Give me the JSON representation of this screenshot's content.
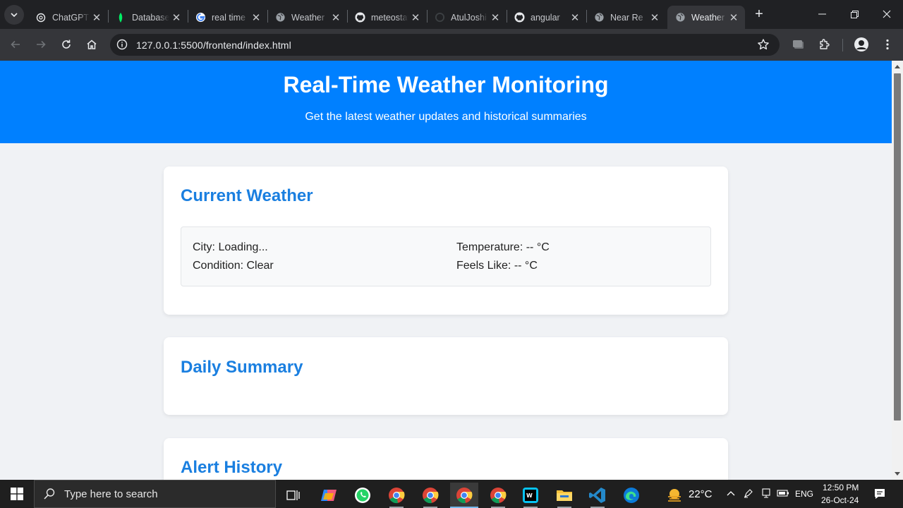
{
  "browser": {
    "tabs": [
      {
        "title": "ChatGPT",
        "favicon": "chatgpt-icon"
      },
      {
        "title": "Database",
        "favicon": "mongodb-leaf-icon"
      },
      {
        "title": "real time",
        "favicon": "google-icon"
      },
      {
        "title": "Weather",
        "favicon": "globe-icon"
      },
      {
        "title": "meteostat",
        "favicon": "github-icon"
      },
      {
        "title": "AtulJoshi",
        "favicon": "github-loading-icon"
      },
      {
        "title": "angular",
        "favicon": "github-icon"
      },
      {
        "title": "Near Re",
        "favicon": "globe-icon"
      },
      {
        "title": "Weather",
        "favicon": "globe-icon",
        "active": true
      }
    ],
    "url": "127.0.0.1:5500/frontend/index.html"
  },
  "page": {
    "header": {
      "title": "Real-Time Weather Monitoring",
      "subtitle": "Get the latest weather updates and historical summaries"
    },
    "current_weather": {
      "heading": "Current Weather",
      "city": "City: Loading...",
      "condition": "Condition: Clear",
      "temperature": "Temperature: -- °C",
      "feels_like": "Feels Like: -- °C"
    },
    "daily_summary": {
      "heading": "Daily Summary"
    },
    "alert_history": {
      "heading": "Alert History"
    },
    "colors": {
      "header_bg": "#0080ff",
      "heading": "#1a7fe0",
      "page_bg": "#f0f2f5"
    }
  },
  "taskbar": {
    "search_placeholder": "Type here to search",
    "weather_temp": "22°C",
    "language": "ENG",
    "time": "12:50 PM",
    "date": "26-Oct-24"
  }
}
